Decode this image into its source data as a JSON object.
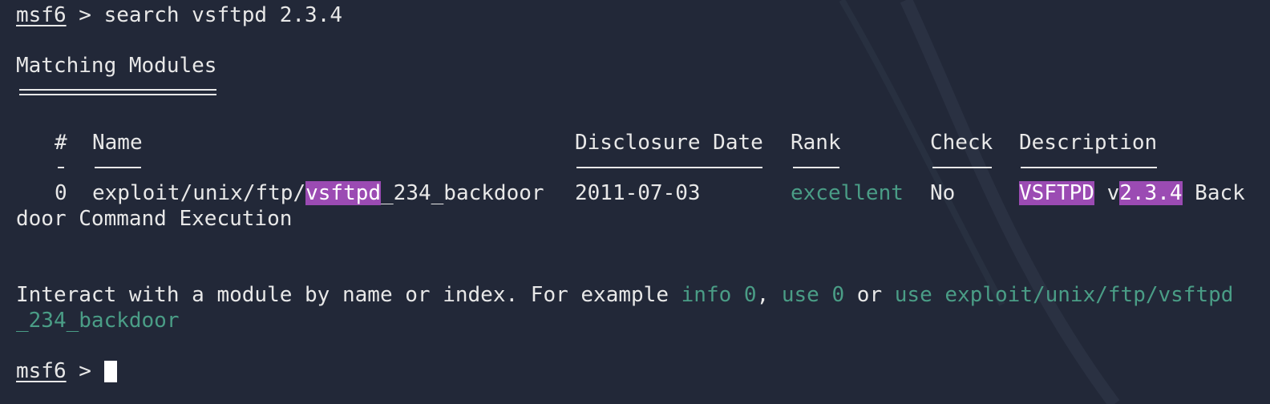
{
  "prompt1": {
    "host": "msf6",
    "symbol": ">",
    "command": "search vsftpd 2.3.4"
  },
  "heading": "Matching Modules",
  "table": {
    "headers": {
      "num": "#",
      "name": "Name",
      "date": "Disclosure Date",
      "rank": "Rank",
      "check": "Check",
      "desc": "Description"
    },
    "row": {
      "num": "0",
      "name_pre": "exploit/unix/ftp/",
      "name_hl": "vsftpd",
      "name_post": "_234_backdoor",
      "date": "2011-07-03",
      "rank": "excellent",
      "check": "No",
      "desc_hl1": "VSFTPD",
      "desc_mid": " v",
      "desc_hl2": "2.3.4",
      "desc_post": " Back",
      "desc_wrap": "door Command Execution"
    }
  },
  "hint": {
    "pre": "Interact with a module by name or index. For example ",
    "cmd1": "info 0",
    "sep1": ", ",
    "cmd2": "use 0",
    "sep2": " or ",
    "cmd3": "use exploit/unix/ftp/vsftpd",
    "wrap": "_234_backdoor"
  },
  "prompt2": {
    "host": "msf6",
    "symbol": ">"
  },
  "colors": {
    "background": "#222838",
    "text": "#e8e8e8",
    "green": "#4a9d86",
    "highlight": "#9b4bb3"
  }
}
